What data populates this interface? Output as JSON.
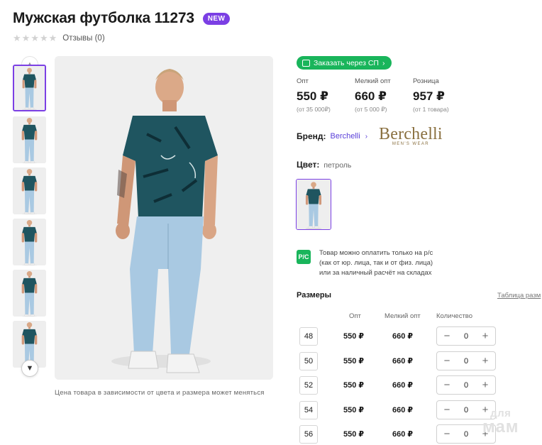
{
  "product": {
    "title": "Мужская футболка 11273",
    "badge": "NEW",
    "reviews_label": "Отзывы (0)",
    "rating": 0,
    "rating_max": 5
  },
  "gallery": {
    "thumbnail_count": 6,
    "selected_index": 0,
    "up_icon": "chevron-up-icon",
    "down_icon": "chevron-down-icon",
    "note": "Цена товара в зависимости от цвета и размера может меняться"
  },
  "order": {
    "label": "Заказать через СП",
    "icon": "cart-icon"
  },
  "prices": [
    {
      "label": "Опт",
      "value": "550 ₽",
      "condition": "(от 35 000₽)"
    },
    {
      "label": "Мелкий опт",
      "value": "660 ₽",
      "condition": "(от 5 000 ₽)"
    },
    {
      "label": "Розница",
      "value": "957 ₽",
      "condition": "(от 1 товара)"
    }
  ],
  "brand": {
    "label": "Бренд:",
    "name": "Berchelli",
    "logo_text": "Berchelli",
    "logo_sub": "MEN'S WEAR"
  },
  "color": {
    "label": "Цвет:",
    "value": "петроль"
  },
  "payment": {
    "icon_text": "Р/С",
    "lines": [
      "Товар можно оплатить только на р/с",
      "(как от юр. лица, так и от физ. лица)",
      "или за наличный расчёт на складах"
    ]
  },
  "sizes": {
    "title": "Размеры",
    "table_link": "Таблица разм",
    "headers": {
      "opt": "Опт",
      "small_opt": "Мелкий опт",
      "quantity": "Количество"
    },
    "rows": [
      {
        "size": "48",
        "opt": "550 ₽",
        "small_opt": "660 ₽",
        "qty": "0"
      },
      {
        "size": "50",
        "opt": "550 ₽",
        "small_opt": "660 ₽",
        "qty": "0"
      },
      {
        "size": "52",
        "opt": "550 ₽",
        "small_opt": "660 ₽",
        "qty": "0"
      },
      {
        "size": "54",
        "opt": "550 ₽",
        "small_opt": "660 ₽",
        "qty": "0"
      },
      {
        "size": "56",
        "opt": "550 ₽",
        "small_opt": "660 ₽",
        "qty": "0"
      }
    ],
    "minus_symbol": "−",
    "plus_symbol": "+"
  },
  "watermark": {
    "top": "для",
    "bottom": "мам"
  },
  "colors": {
    "accent_purple": "#7b3fe4",
    "green": "#19b55b",
    "link": "#5a3fd9",
    "shirt": "#1f5560",
    "jeans": "#a9c9e2",
    "brand_gold": "#8a7040"
  }
}
